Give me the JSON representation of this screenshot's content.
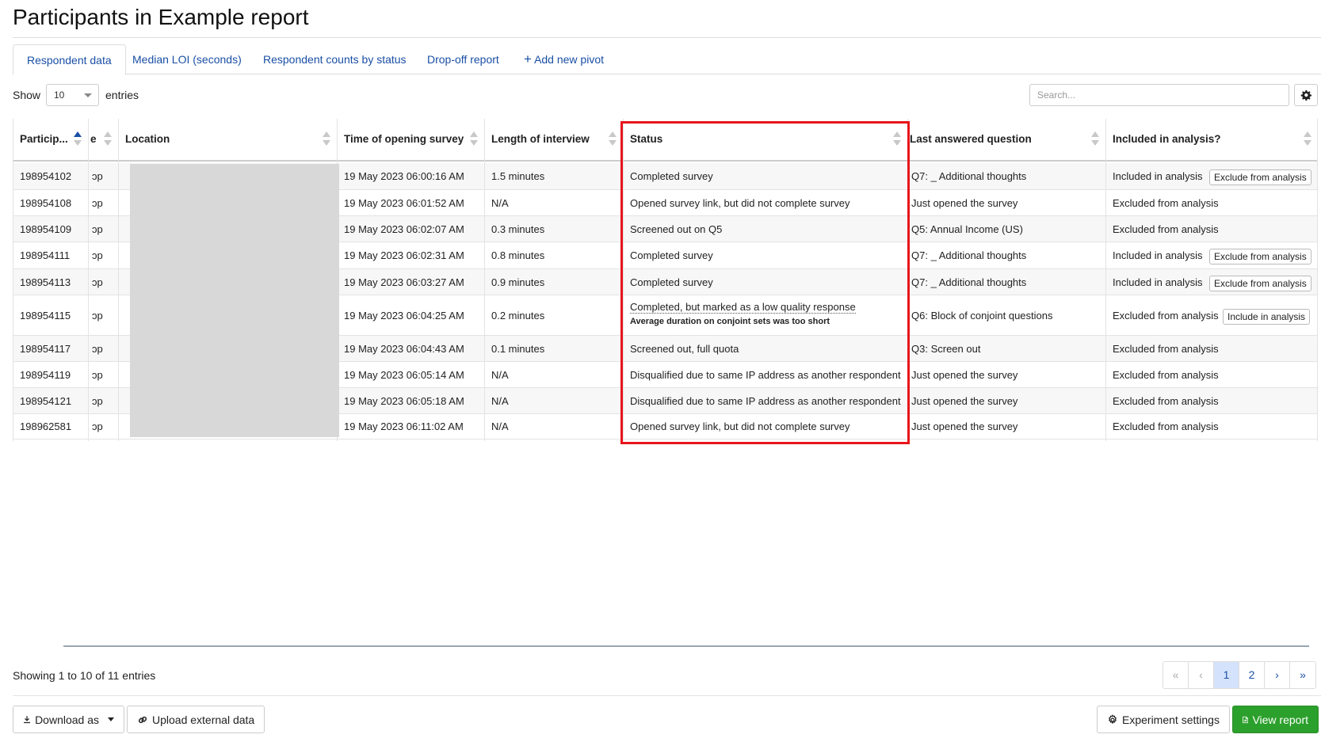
{
  "title": "Participants in Example report",
  "tabs": [
    {
      "label": "Respondent data",
      "active": true
    },
    {
      "label": "Median LOI (seconds)"
    },
    {
      "label": "Respondent counts by status"
    },
    {
      "label": "Drop-off report"
    },
    {
      "label": "Add new pivot",
      "icon": "plus-icon"
    }
  ],
  "controls": {
    "show_label": "Show",
    "entries_value": "10",
    "entries_label": "entries",
    "search_placeholder": "Search...",
    "settings_icon": "gear-icon"
  },
  "table": {
    "headers": [
      "Particip...",
      "e",
      "Location",
      "Time of opening survey",
      "Length of interview",
      "Status",
      "Last answered question",
      "Included in analysis?"
    ],
    "rows": [
      {
        "id": "198954102",
        "e": "ɔp",
        "time": "19 May 2023 06:00:16 AM",
        "length": "1.5 minutes",
        "status": "Completed survey",
        "last_q": "Q7: _ Additional thoughts",
        "included": "Included in analysis",
        "action": "Exclude from analysis"
      },
      {
        "id": "198954108",
        "e": "ɔp",
        "time": "19 May 2023 06:01:52 AM",
        "length": "N/A",
        "status": "Opened survey link, but did not complete survey",
        "last_q": "Just opened the survey",
        "included": "Excluded from analysis"
      },
      {
        "id": "198954109",
        "e": "ɔp",
        "time": "19 May 2023 06:02:07 AM",
        "length": "0.3 minutes",
        "status": "Screened out on Q5",
        "last_q": "Q5: Annual Income (US)",
        "included": "Excluded from analysis"
      },
      {
        "id": "198954111",
        "e": "ɔp",
        "time": "19 May 2023 06:02:31 AM",
        "length": "0.8 minutes",
        "status": "Completed survey",
        "last_q": "Q7: _ Additional thoughts",
        "included": "Included in analysis",
        "action": "Exclude from analysis"
      },
      {
        "id": "198954113",
        "e": "ɔp",
        "time": "19 May 2023 06:03:27 AM",
        "length": "0.9 minutes",
        "status": "Completed survey",
        "last_q": "Q7: _ Additional thoughts",
        "included": "Included in analysis",
        "action": "Exclude from analysis"
      },
      {
        "id": "198954115",
        "e": "ɔp",
        "time": "19 May 2023 06:04:25 AM",
        "length": "0.2 minutes",
        "status": "Completed, but marked as a low quality response",
        "status_note": "Average duration on conjoint sets was too short",
        "last_q": "Q6: Block of conjoint questions",
        "included": "Excluded from analysis",
        "action": "Include in analysis"
      },
      {
        "id": "198954117",
        "e": "ɔp",
        "time": "19 May 2023 06:04:43 AM",
        "length": "0.1 minutes",
        "status": "Screened out, full quota",
        "last_q": "Q3: Screen out",
        "included": "Excluded from analysis"
      },
      {
        "id": "198954119",
        "e": "ɔp",
        "time": "19 May 2023 06:05:14 AM",
        "length": "N/A",
        "status": "Disqualified due to same IP address as another respondent",
        "last_q": "Just opened the survey",
        "included": "Excluded from analysis"
      },
      {
        "id": "198954121",
        "e": "ɔp",
        "time": "19 May 2023 06:05:18 AM",
        "length": "N/A",
        "status": "Disqualified due to same IP address as another respondent",
        "last_q": "Just opened the survey",
        "included": "Excluded from analysis"
      },
      {
        "id": "198962581",
        "e": "ɔp",
        "time": "19 May 2023 06:11:02 AM",
        "length": "N/A",
        "status": "Opened survey link, but did not complete survey",
        "last_q": "Just opened the survey",
        "included": "Excluded from analysis"
      }
    ]
  },
  "footer": {
    "showing": "Showing 1 to 10 of 11 entries",
    "pagination": [
      "«",
      "‹",
      "1",
      "2",
      "›",
      "»"
    ],
    "current_page": "1",
    "download_label": "Download as",
    "upload_label": "Upload external data",
    "settings_label": "Experiment settings",
    "view_label": "View report"
  },
  "colors": {
    "link": "#1a4fa5",
    "highlight_border": "#e8151b",
    "view_button": "#2ca02c"
  }
}
